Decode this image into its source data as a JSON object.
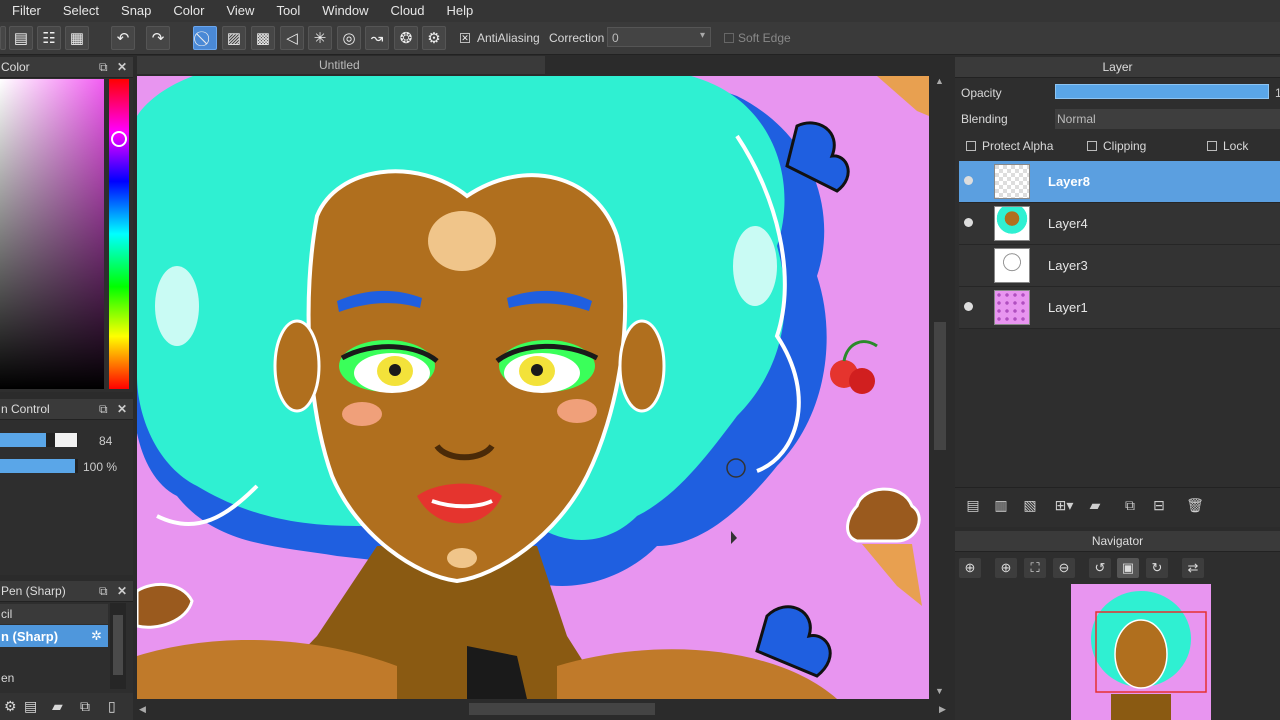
{
  "menu": [
    "Filter",
    "Select",
    "Snap",
    "Color",
    "View",
    "Tool",
    "Window",
    "Cloud",
    "Help"
  ],
  "toolbar": {
    "antialiasing_label": "AntiAliasing",
    "correction_label": "Correction",
    "correction_value": "0",
    "soft_edge_label": "Soft Edge"
  },
  "color_panel": {
    "title": "Color"
  },
  "brush_control": {
    "title": "n Control",
    "size_value": "84",
    "opacity_value": "100 %",
    "size_fraction": 0.84,
    "opacity_fraction": 1.0
  },
  "brush_list": {
    "title": "Pen (Sharp)",
    "items": [
      "cil",
      "n (Sharp)",
      "en"
    ]
  },
  "document": {
    "tab_title": "Untitled"
  },
  "layer_panel": {
    "title": "Layer",
    "opacity_label": "Opacity",
    "opacity_value": "1",
    "blending_label": "Blending",
    "blending_value": "Normal",
    "protect_alpha_label": "Protect Alpha",
    "clipping_label": "Clipping",
    "lock_label": "Lock",
    "layers": [
      {
        "name": "Layer8",
        "visible": true,
        "active": true
      },
      {
        "name": "Layer4",
        "visible": true,
        "active": false
      },
      {
        "name": "Layer3",
        "visible": false,
        "active": false
      },
      {
        "name": "Layer1",
        "visible": true,
        "active": false
      }
    ]
  },
  "navigator": {
    "title": "Navigator"
  },
  "colors": {
    "accent": "#4a89d6",
    "canvas_bg": "#e895f0",
    "hair": "#2ff0d2",
    "hair_shadow": "#1f5fe0",
    "skin": "#b06f1e"
  }
}
